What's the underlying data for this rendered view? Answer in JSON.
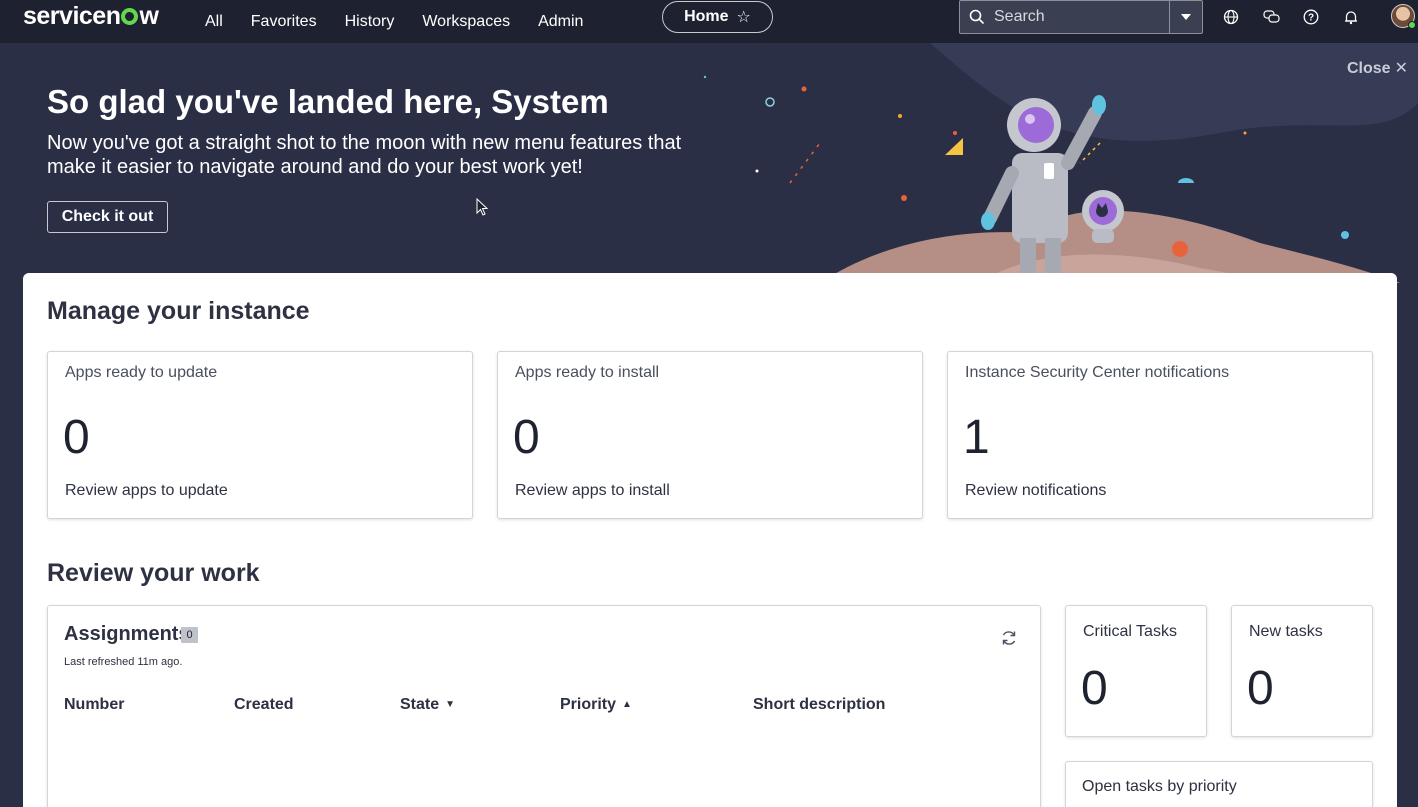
{
  "nav": {
    "logo": "servicenow",
    "items": [
      "All",
      "Favorites",
      "History",
      "Workspaces",
      "Admin"
    ],
    "home_label": "Home",
    "search_placeholder": "Search",
    "icons": [
      "globe-icon",
      "chat-icon",
      "help-icon",
      "bell-icon"
    ]
  },
  "banner": {
    "title": "So glad you've landed here, System",
    "subtitle": "Now you've got a straight shot to the moon with new menu features that make it easier to navigate around and do your best work yet!",
    "button_label": "Check it out",
    "close_label": "Close"
  },
  "manage": {
    "heading": "Manage your instance",
    "tiles": [
      {
        "title": "Apps ready to update",
        "count": "0",
        "link": "Review apps to update"
      },
      {
        "title": "Apps ready to install",
        "count": "0",
        "link": "Review apps to install"
      },
      {
        "title": "Instance Security Center notifications",
        "count": "1",
        "link": "Review notifications"
      }
    ]
  },
  "work": {
    "heading": "Review your work",
    "assignments": {
      "title": "Assignments",
      "badge": "0",
      "last_refreshed": "Last refreshed 11m ago.",
      "columns": [
        "Number",
        "Created",
        "State",
        "Priority",
        "Short description"
      ]
    },
    "critical": {
      "title": "Critical Tasks",
      "count": "0"
    },
    "new_tasks": {
      "title": "New tasks",
      "count": "0"
    },
    "open_by_priority": {
      "title": "Open tasks by priority"
    }
  },
  "colors": {
    "nav_bg": "#1e2130",
    "banner_bg": "#2b2f45",
    "accent_green": "#62d84e",
    "card_bg": "#ffffff"
  }
}
